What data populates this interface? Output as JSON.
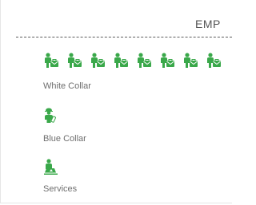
{
  "header": {
    "title": "EMP"
  },
  "colors": {
    "icon_green": "#3aa84a",
    "label_gray": "#6e6e6e"
  },
  "categories": [
    {
      "label": "White Collar",
      "icon": "white-collar-worker-icon",
      "icon_count": 8
    },
    {
      "label": "Blue Collar",
      "icon": "blue-collar-worker-icon",
      "icon_count": 1
    },
    {
      "label": "Services",
      "icon": "services-worker-icon",
      "icon_count": 1
    }
  ]
}
